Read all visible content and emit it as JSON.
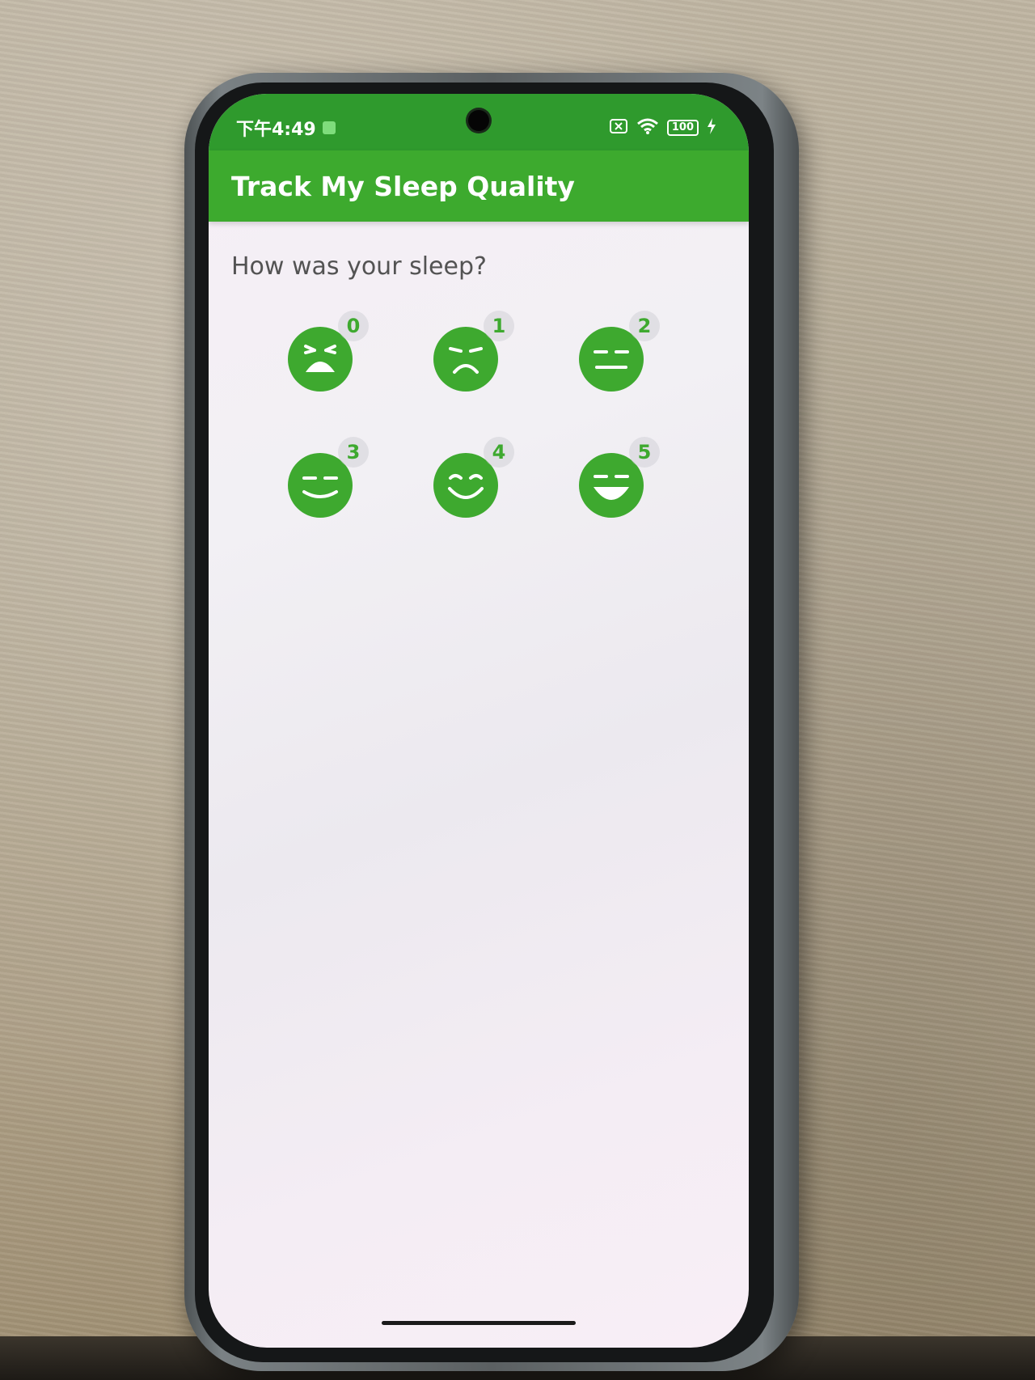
{
  "status_bar": {
    "time": "下午4:49",
    "battery": "100"
  },
  "app_bar": {
    "title": "Track My Sleep Quality"
  },
  "main": {
    "prompt": "How was your sleep?",
    "ratings": [
      {
        "label": "0",
        "icon": "crying-face-icon"
      },
      {
        "label": "1",
        "icon": "sad-face-icon"
      },
      {
        "label": "2",
        "icon": "neutral-face-icon"
      },
      {
        "label": "3",
        "icon": "slight-smile-face-icon"
      },
      {
        "label": "4",
        "icon": "smile-face-icon"
      },
      {
        "label": "5",
        "icon": "laughing-face-icon"
      }
    ]
  },
  "colors": {
    "primary": "#3daa2e",
    "status_bar": "#2f9a2d",
    "face": "#3ea92f"
  }
}
